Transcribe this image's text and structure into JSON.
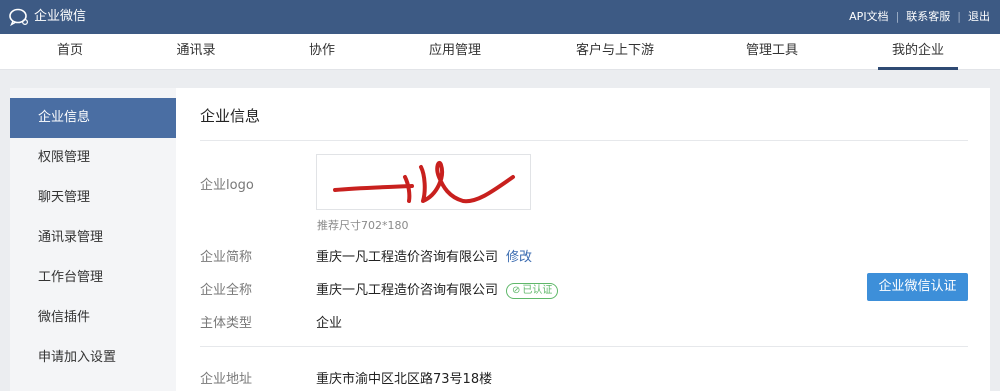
{
  "topbar": {
    "brand": "企业微信",
    "links": [
      "API文档",
      "联系客服",
      "退出"
    ]
  },
  "nav": {
    "items": [
      "首页",
      "通讯录",
      "协作",
      "应用管理",
      "客户与上下游",
      "管理工具",
      "我的企业"
    ],
    "active": "我的企业"
  },
  "sidebar": {
    "items": [
      "企业信息",
      "权限管理",
      "聊天管理",
      "通讯录管理",
      "工作台管理",
      "微信插件",
      "申请加入设置"
    ],
    "active": "企业信息"
  },
  "main": {
    "title": "企业信息",
    "logo_label": "企业logo",
    "logo_hint": "推荐尺寸702*180",
    "short_name_label": "企业简称",
    "short_name_value": "重庆一凡工程造价咨询有限公司",
    "edit_link": "修改",
    "full_name_label": "企业全称",
    "full_name_value": "重庆一凡工程造价咨询有限公司",
    "verified_badge": "已认证",
    "entity_type_label": "主体类型",
    "entity_type_value": "企业",
    "address_label": "企业地址",
    "address_value": "重庆市渝中区北区路73号18楼",
    "cert_button": "企业微信认证"
  },
  "colors": {
    "topbar": "#3d5a84",
    "sidebar_active": "#4a6ea3",
    "button": "#3d8fd9",
    "badge": "#5fb86a",
    "logo_red": "#c8201e"
  }
}
